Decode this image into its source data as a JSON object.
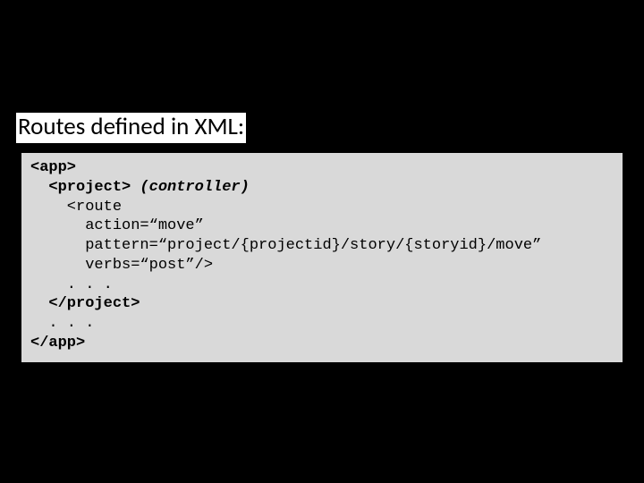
{
  "heading": "Routes defined in XML:",
  "code": {
    "l1": "<app>",
    "l2a": "  <project>",
    "l2b": " (controller)",
    "l3": "    <route",
    "l4": "      action=“move”",
    "l5": "      pattern=“project/{projectid}/story/{storyid}/move”",
    "l6": "      verbs=“post”/>",
    "l7": "    . . .",
    "l8": "  </project>",
    "l9": "  . . .",
    "l10": "</app>"
  }
}
